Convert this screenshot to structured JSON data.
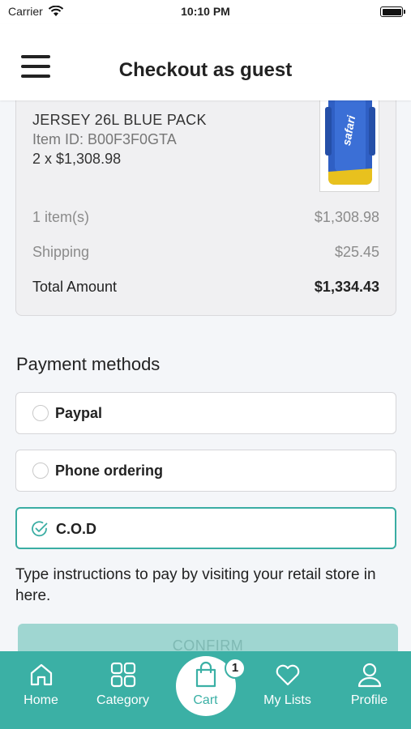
{
  "status_bar": {
    "carrier": "Carrier",
    "time": "10:10 PM"
  },
  "header": {
    "title": "Checkout as guest"
  },
  "product": {
    "name": "JERSEY 26L BLUE PACK",
    "item_id": "Item ID: B00F3F0GTA",
    "quantity_price": "2 x $1,308.98",
    "image_text": "safari"
  },
  "summary": {
    "items_label": "1 item(s)",
    "items_value": "$1,308.98",
    "shipping_label": "Shipping",
    "shipping_value": "$25.45",
    "total_label": "Total Amount",
    "total_value": "$1,334.43"
  },
  "payment": {
    "title": "Payment methods",
    "options": [
      {
        "label": "Paypal",
        "selected": false
      },
      {
        "label": "Phone ordering",
        "selected": false
      },
      {
        "label": "C.O.D",
        "selected": true
      }
    ],
    "instructions": "Type instructions to pay by visiting your retail store in here."
  },
  "confirm_label": "CONFIRM",
  "tabbar": {
    "tabs": [
      {
        "label": "Home",
        "icon": "home-icon"
      },
      {
        "label": "Category",
        "icon": "grid-icon"
      },
      {
        "label": "Cart",
        "icon": "shopping-bag-icon"
      },
      {
        "label": "My Lists",
        "icon": "heart-icon"
      },
      {
        "label": "Profile",
        "icon": "user-icon"
      }
    ],
    "cart_badge": "1"
  },
  "colors": {
    "accent": "#3bb0a5",
    "confirm_disabled": "#9fd6d1"
  }
}
